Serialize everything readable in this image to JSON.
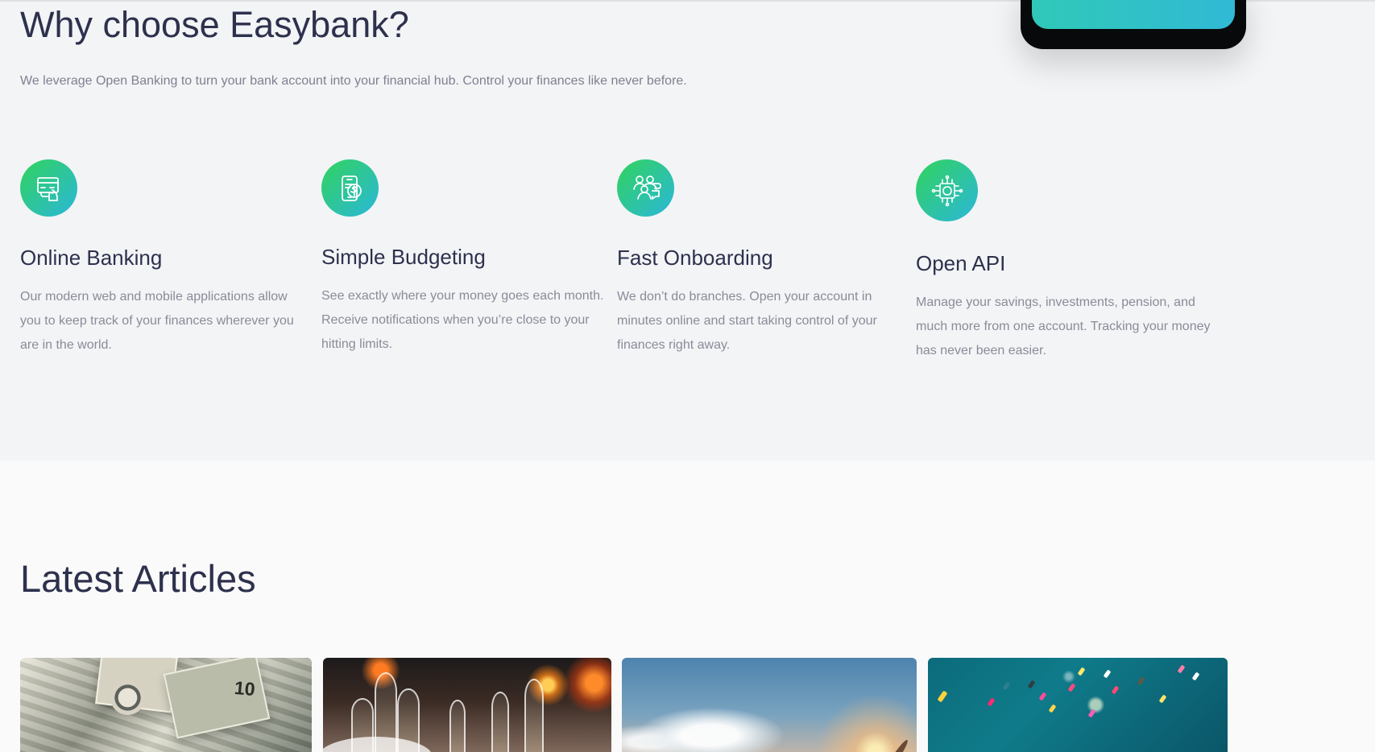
{
  "why": {
    "title": "Why choose Easybank?",
    "intro": "We leverage Open Banking to turn your bank account into your financial hub. Control your finances like never before."
  },
  "features": [
    {
      "icon": "online-banking-icon",
      "title": "Online Banking",
      "text": "Our modern web and mobile applications allow you to keep track of your finances wherever you are in the world."
    },
    {
      "icon": "simple-budgeting-icon",
      "title": "Simple Budgeting",
      "text": "See exactly where your money goes each month. Receive notifications when you’re close to your hitting limits."
    },
    {
      "icon": "fast-onboarding-icon",
      "title": "Fast Onboarding",
      "text": "We don’t do branches. Open your account in minutes online and start taking control of your finances right away."
    },
    {
      "icon": "open-api-icon",
      "title": "Open API",
      "text": "Manage your savings, investments, pension, and much more from one account. Tracking your money has never been easier."
    }
  ],
  "articles": {
    "title": "Latest Articles",
    "images": [
      {
        "name": "currency-notes-image"
      },
      {
        "name": "restaurant-dinner-image"
      },
      {
        "name": "sky-plane-image"
      },
      {
        "name": "confetti-image"
      }
    ]
  },
  "colors": {
    "title": "#2d314d",
    "text": "#8a8b99",
    "accent_green": "#31d35c",
    "accent_cyan": "#2bb7da",
    "section_background": "#f3f4f6",
    "page_background": "#fafafa"
  }
}
